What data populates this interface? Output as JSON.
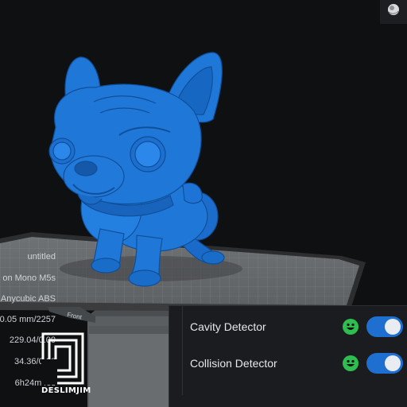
{
  "viewport": {
    "print_info": {
      "file_name": "untitled",
      "printer": "on Mono M5s",
      "material": "Anycubic ABS",
      "layer_height": "0.05 mm/2257",
      "volume": "229.04/0.00",
      "weight": "34.36/0.00",
      "print_time": "6h24m45s"
    },
    "front_label": "Front",
    "model_color": "#1f78d8",
    "corner_icon": "sphere-view-icon"
  },
  "detectors": {
    "cavity": {
      "label": "Cavity Detector",
      "status_icon": "smiley-ok-icon",
      "enabled": true
    },
    "collision": {
      "label": "Collision Detector",
      "status_icon": "smiley-ok-icon",
      "enabled": true
    }
  },
  "watermark": {
    "text": "DESLIMJIM"
  },
  "colors": {
    "background": "#0f1012",
    "toggle_on": "#1e6fd0",
    "status_ok": "#2ebd4f",
    "panel_bg": "#1a1c1f"
  }
}
